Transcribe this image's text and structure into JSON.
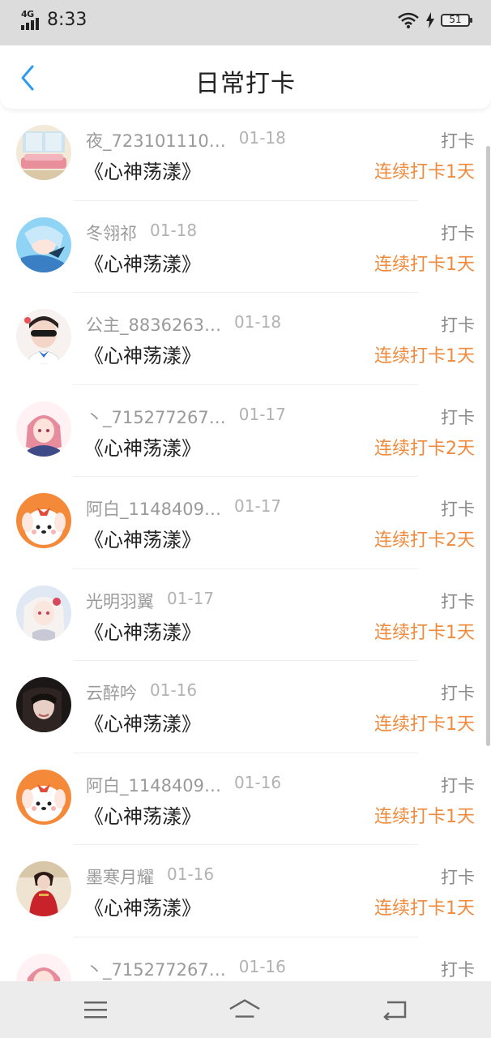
{
  "status": {
    "network": "4G",
    "time": "8:33",
    "battery": "51"
  },
  "header": {
    "title": "日常打卡"
  },
  "list": [
    {
      "name": "夜_723101110…",
      "date": "01-18",
      "book": "《心神荡漾》",
      "action": "打卡",
      "streak": "连续打卡1天",
      "avatar": "room"
    },
    {
      "name": "冬翎祁",
      "date": "01-18",
      "book": "《心神荡漾》",
      "action": "打卡",
      "streak": "连续打卡1天",
      "avatar": "anime-blue"
    },
    {
      "name": "公主_8836263…",
      "date": "01-18",
      "book": "《心神荡漾》",
      "action": "打卡",
      "streak": "连续打卡1天",
      "avatar": "kid"
    },
    {
      "name": "丶_715277267…",
      "date": "01-17",
      "book": "《心神荡漾》",
      "action": "打卡",
      "streak": "连续打卡2天",
      "avatar": "anime-pink"
    },
    {
      "name": "阿白_1148409…",
      "date": "01-17",
      "book": "《心神荡漾》",
      "action": "打卡",
      "streak": "连续打卡2天",
      "avatar": "dog"
    },
    {
      "name": "光明羽翼",
      "date": "01-17",
      "book": "《心神荡漾》",
      "action": "打卡",
      "streak": "连续打卡1天",
      "avatar": "anime-white"
    },
    {
      "name": "云醉吟",
      "date": "01-16",
      "book": "《心神荡漾》",
      "action": "打卡",
      "streak": "连续打卡1天",
      "avatar": "dark"
    },
    {
      "name": "阿白_1148409…",
      "date": "01-16",
      "book": "《心神荡漾》",
      "action": "打卡",
      "streak": "连续打卡1天",
      "avatar": "dog"
    },
    {
      "name": "墨寒月耀",
      "date": "01-16",
      "book": "《心神荡漾》",
      "action": "打卡",
      "streak": "连续打卡1天",
      "avatar": "red-dress"
    },
    {
      "name": "丶_715277267…",
      "date": "01-16",
      "book": "",
      "action": "打卡",
      "streak": "",
      "avatar": "anime-pink"
    }
  ],
  "colors": {
    "accent": "#2d9cf0",
    "streak": "#f08a3c"
  },
  "bottom_nav": {
    "menu_icon": "menu-icon",
    "home_icon": "home-icon",
    "back_icon": "back-icon"
  }
}
